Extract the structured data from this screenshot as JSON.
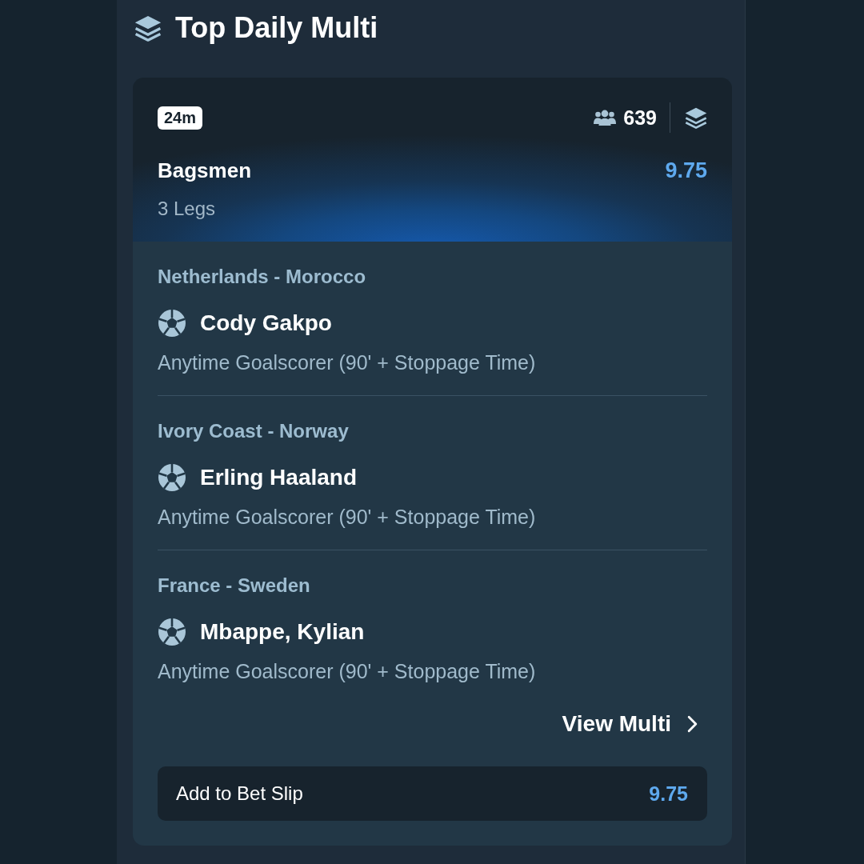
{
  "header": {
    "title": "Top Daily Multi"
  },
  "multi": {
    "time_badge": "24m",
    "followers": "639",
    "name": "Bagsmen",
    "odds": "9.75",
    "legs_count": "3 Legs",
    "legs": [
      {
        "match": "Netherlands - Morocco",
        "player": "Cody Gakpo",
        "market": "Anytime Goalscorer (90' + Stoppage Time)"
      },
      {
        "match": "Ivory Coast - Norway",
        "player": "Erling Haaland",
        "market": "Anytime Goalscorer (90' + Stoppage Time)"
      },
      {
        "match": "France - Sweden",
        "player": "Mbappe, Kylian",
        "market": "Anytime Goalscorer (90' + Stoppage Time)"
      }
    ],
    "view_link": "View Multi",
    "bet_slip_button": {
      "label": "Add to Bet Slip",
      "odds": "9.75"
    }
  }
}
